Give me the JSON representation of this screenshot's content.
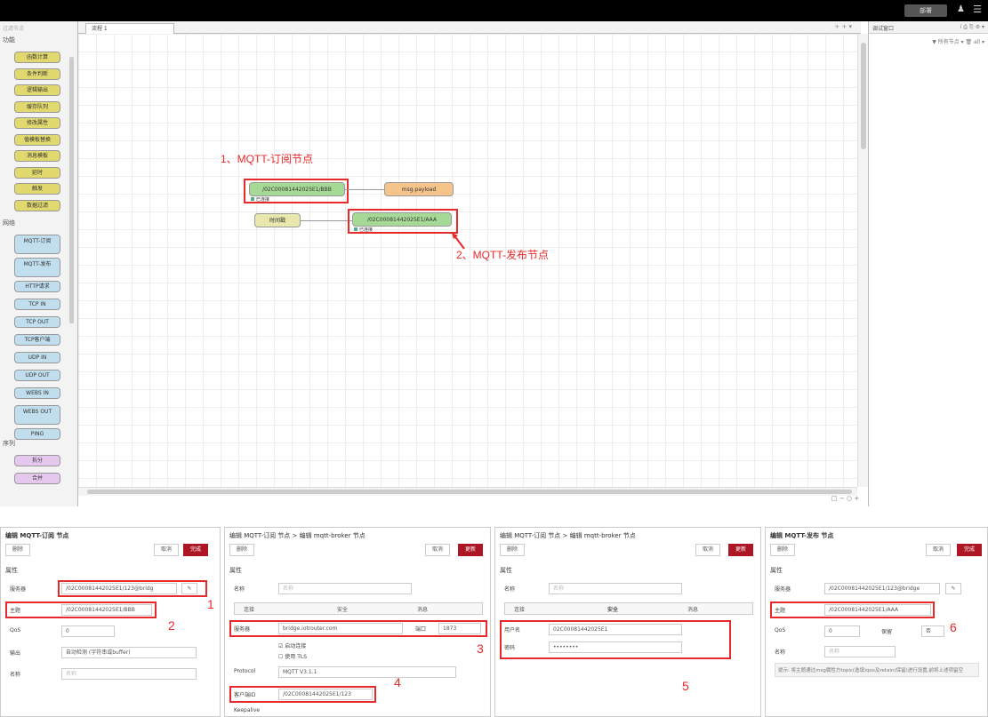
{
  "header": {
    "deploy_label": "部署",
    "user_icon": "user-icon",
    "menu_icon": "menu-icon"
  },
  "palette": {
    "search_placeholder": "过滤节点",
    "cat_function": "功能",
    "function_nodes": [
      "函数计算",
      "条件判断",
      "逻辑输出",
      "缓存队列",
      "修改属性",
      "值模板替换",
      "消息模板",
      "延时",
      "触发",
      "数据过滤"
    ],
    "cat_network": "网络",
    "network_nodes": [
      "MQTT-订阅",
      "MQTT-发布",
      "HTTP请求",
      "TCP IN",
      "TCP OUT",
      "TCP客户端",
      "UDP IN",
      "UDP OUT",
      "WEBS IN",
      "WEBS OUT",
      "PING"
    ],
    "cat_sequence": "序列",
    "sequence_nodes": [
      "拆分",
      "合并"
    ]
  },
  "workspace": {
    "tab_label": "流程 1",
    "tab_tools": "+ +  ▾",
    "zoom": "□ − ○ +",
    "annotation1": "1、MQTT-订阅节点",
    "annotation2": "2、MQTT-发布节点",
    "node_sub": "/02C00081442025E1/BBB",
    "node_sub_status": "已连接",
    "node_debug": "msg.payload",
    "node_inject": "时间戳",
    "node_pub": "/02C00081442025E1/AAA",
    "node_pub_status": "已连接"
  },
  "side": {
    "title": "调试窗口",
    "tabs": "i  ⎙  ⎘  ⚙  ▾",
    "filter": "▼ 所有节点 ▾   🗑 all ▾"
  },
  "panel1": {
    "title": "编辑 MQTT-订阅 节点",
    "delete": "删除",
    "cancel": "取消",
    "done": "完成",
    "props": "属性",
    "server_label": "服务器",
    "server_value": "/02C00081442025E1/123@bridg",
    "topic_label": "主题",
    "topic_value": "/02C00081442025E1/BBB",
    "qos_label": "QoS",
    "qos_value": "0",
    "output_label": "输出",
    "output_value": "自动检测 (字符串或buffer)",
    "name_label": "名称",
    "name_placeholder": "名称",
    "num1": "1",
    "num2": "2"
  },
  "panel2": {
    "title": "编辑 MQTT-订阅 节点 > 编辑 mqtt-broker 节点",
    "delete": "删除",
    "cancel": "取消",
    "update": "更新",
    "props": "属性",
    "name_label": "名称",
    "name_placeholder": "名称",
    "tab_conn": "连接",
    "tab_sec": "安全",
    "tab_msg": "消息",
    "server_label": "服务器",
    "server_value": "bridge.iotrouter.com",
    "port_label": "端口",
    "port_value": "1873",
    "auto_conn": "启动连接",
    "use_tls": "使用 TLS",
    "protocol_label": "Protocol",
    "protocol_value": "MQTT V3.1.1",
    "client_label": "客户端ID",
    "client_value": "/02C00081442025E1/123",
    "keepalive": "Keepalive",
    "num3": "3",
    "num4": "4"
  },
  "panel3": {
    "title": "编辑 MQTT-订阅 节点 > 编辑 mqtt-broker 节点",
    "delete": "删除",
    "cancel": "取消",
    "update": "更新",
    "props": "属性",
    "name_label": "名称",
    "name_placeholder": "名称",
    "tab_conn": "连接",
    "tab_sec": "安全",
    "tab_msg": "消息",
    "user_label": "用户名",
    "user_value": "02C00081442025E1",
    "pass_label": "密码",
    "pass_value": "••••••••",
    "num5": "5"
  },
  "panel4": {
    "title": "编辑 MQTT-发布 节点",
    "delete": "删除",
    "cancel": "取消",
    "done": "完成",
    "props": "属性",
    "server_label": "服务器",
    "server_value": "/02C00081442025E1/123@bridge",
    "topic_label": "主题",
    "topic_value": "/02C00081442025E1/AAA",
    "qos_label": "QoS",
    "qos_value": "0",
    "retain_label": "保留",
    "retain_value": "否",
    "name_label": "名称",
    "name_placeholder": "名称",
    "note": "提示: 将主题通过msg属性方topic(选填)qos及retain(保留)进行设置,前将上述项留空",
    "num6": "6"
  }
}
